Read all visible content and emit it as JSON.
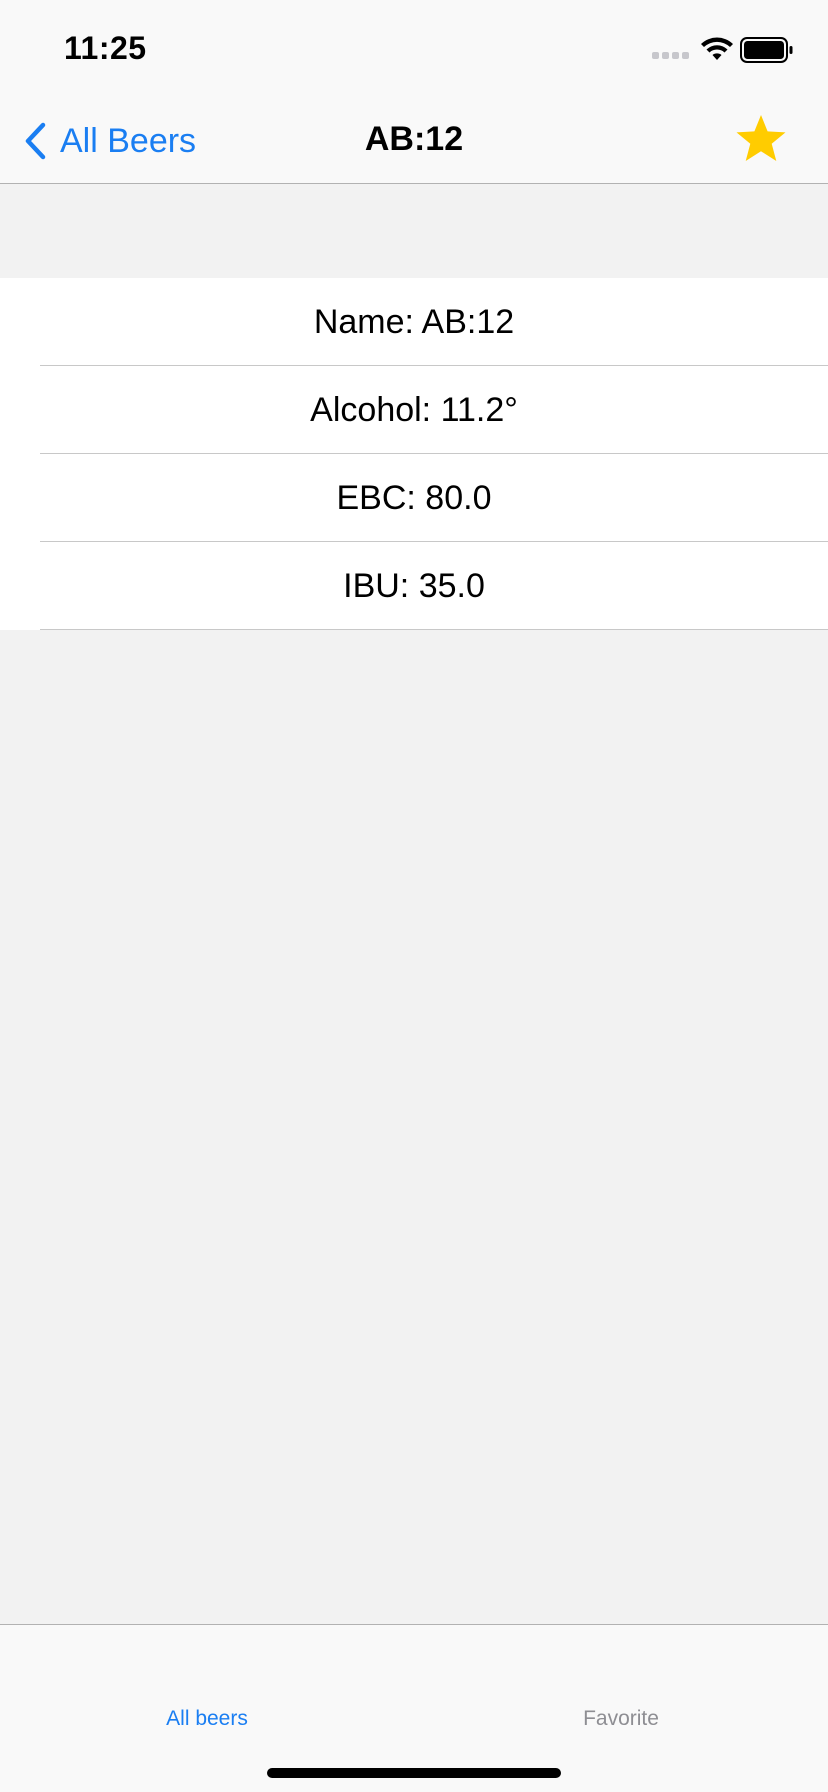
{
  "status_bar": {
    "time": "11:25"
  },
  "nav": {
    "back_label": "All Beers",
    "title": "AB:12",
    "favorite_icon": "star-icon",
    "favorite_color": "#ffcc00",
    "accent_color": "#1a7ef2"
  },
  "details": {
    "rows": [
      {
        "label": "Name: AB:12"
      },
      {
        "label": "Alcohol: 11.2°"
      },
      {
        "label": "EBC: 80.0"
      },
      {
        "label": "IBU: 35.0"
      }
    ]
  },
  "tabbar": {
    "tabs": [
      {
        "label": "All beers",
        "selected": true
      },
      {
        "label": "Favorite",
        "selected": false
      }
    ]
  }
}
